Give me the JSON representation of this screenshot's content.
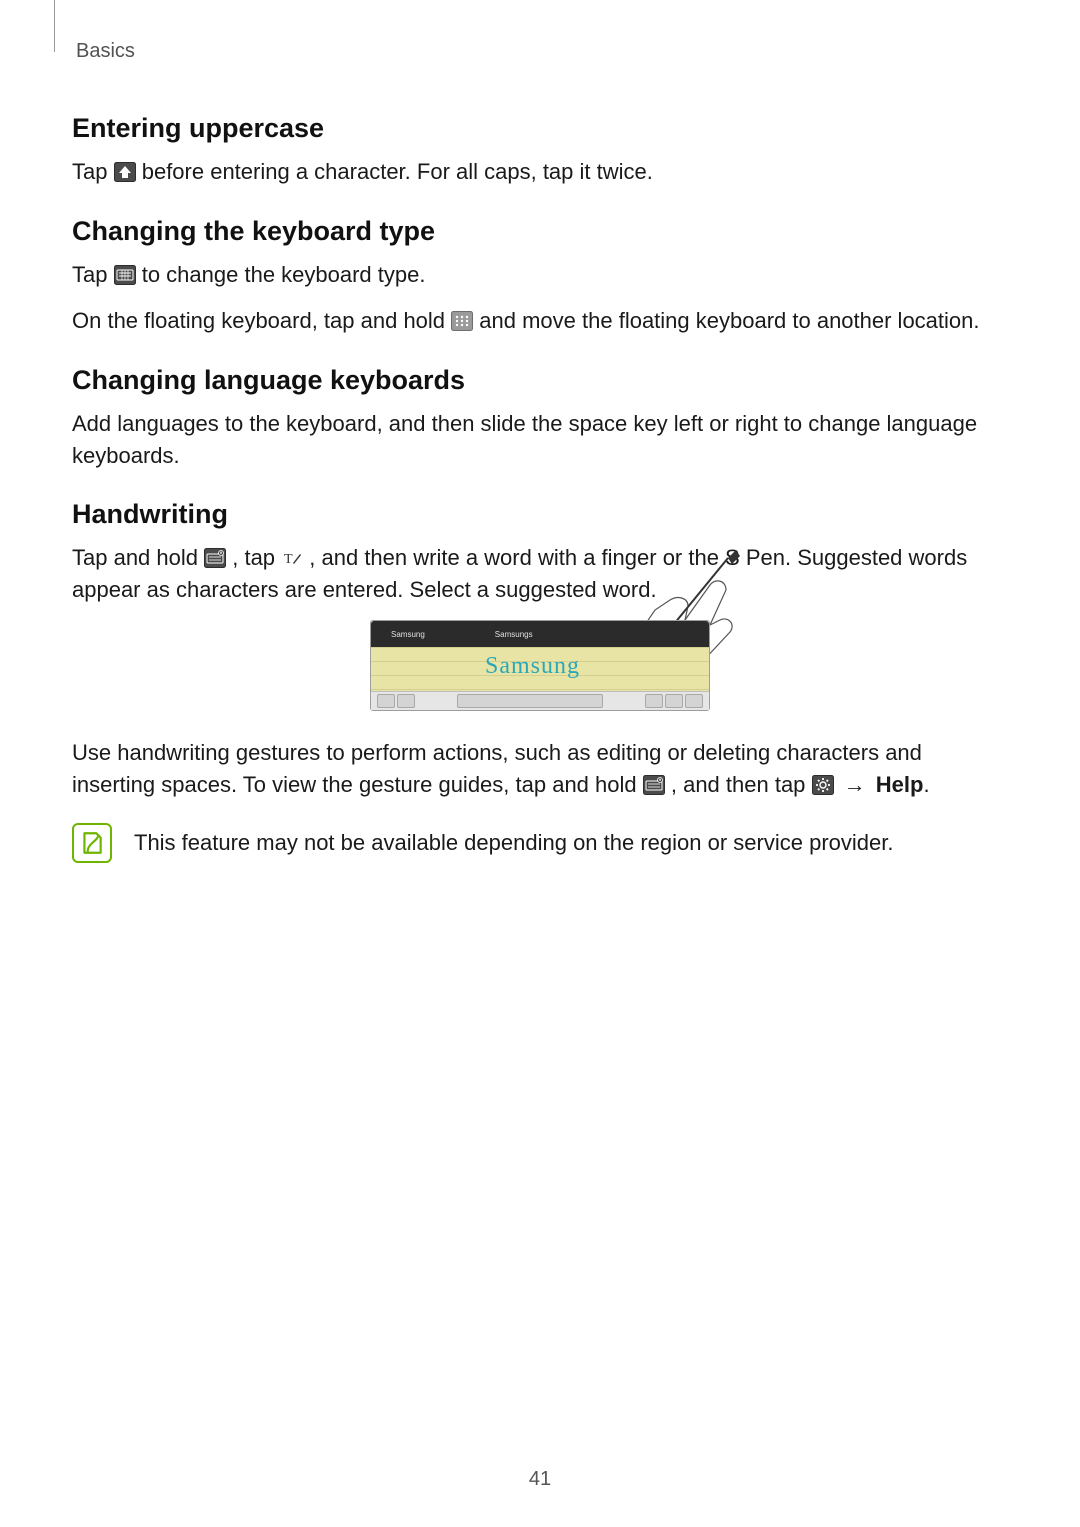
{
  "chapter": "Basics",
  "page_number": "41",
  "sections": {
    "upper": {
      "heading": "Entering uppercase",
      "p1a": "Tap ",
      "p1b": " before entering a character. For all caps, tap it twice."
    },
    "kbtype": {
      "heading": "Changing the keyboard type",
      "p1a": "Tap ",
      "p1b": " to change the keyboard type.",
      "p2a": "On the floating keyboard, tap and hold ",
      "p2b": " and move the floating keyboard to another location."
    },
    "lang": {
      "heading": "Changing language keyboards",
      "p1": "Add languages to the keyboard, and then slide the space key left or right to change language keyboards."
    },
    "hand": {
      "heading": "Handwriting",
      "p1a": "Tap and hold ",
      "p1b": ", tap ",
      "p1c": ", and then write a word with a finger or the S Pen. Suggested words appear as characters are entered. Select a suggested word.",
      "p2a": "Use handwriting gestures to perform actions, such as editing or deleting characters and inserting spaces. To view the gesture guides, tap and hold ",
      "p2b": ", and then tap ",
      "p2_arrow": "→",
      "p2_help": "Help",
      "p2_end": "."
    }
  },
  "figure": {
    "sugg1": "Samsung",
    "sugg2": "Samsungs",
    "handwriting": "Samsung"
  },
  "note_text": "This feature may not be available depending on the region or service provider.",
  "icons": {
    "shift": "shift-up-icon",
    "keyboard": "keyboard-icon",
    "drag": "drag-handle-icon",
    "mic_kb": "mic-keyboard-icon",
    "t_pen": "t-handwriting-icon",
    "gear": "gear-icon"
  }
}
